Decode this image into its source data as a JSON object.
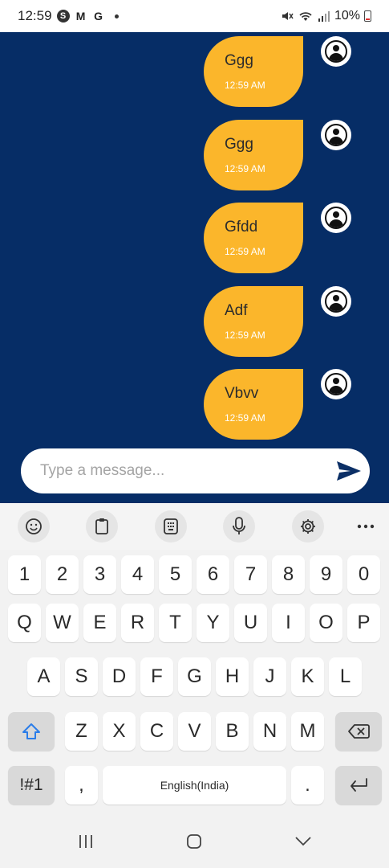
{
  "status_bar": {
    "time": "12:59",
    "apps": [
      "S",
      "M",
      "G"
    ],
    "battery": "10%"
  },
  "messages": [
    {
      "text": "Ggg",
      "time": "12:59 AM"
    },
    {
      "text": "Ggg",
      "time": "12:59 AM"
    },
    {
      "text": "Gfdd",
      "time": "12:59 AM"
    },
    {
      "text": "Adf",
      "time": "12:59 AM"
    },
    {
      "text": "Vbvv",
      "time": "12:59 AM"
    }
  ],
  "composer": {
    "placeholder": "Type a message..."
  },
  "keyboard": {
    "number_row": [
      "1",
      "2",
      "3",
      "4",
      "5",
      "6",
      "7",
      "8",
      "9",
      "0"
    ],
    "row1": [
      "Q",
      "W",
      "E",
      "R",
      "T",
      "Y",
      "U",
      "I",
      "O",
      "P"
    ],
    "row2": [
      "A",
      "S",
      "D",
      "F",
      "G",
      "H",
      "J",
      "K",
      "L"
    ],
    "row3": [
      "Z",
      "X",
      "C",
      "V",
      "B",
      "N",
      "M"
    ],
    "symbols_label": "!#1",
    "comma": ",",
    "space_label": "English(India)",
    "period": "."
  },
  "colors": {
    "chat_background": "#062d66",
    "bubble": "#fbb62b",
    "send_icon": "#0b2f66",
    "shift_icon": "#2b7de9"
  },
  "icons": {
    "toolbar": [
      "emoji-icon",
      "clipboard-icon",
      "keypad-icon",
      "microphone-icon",
      "settings-icon",
      "more-icon"
    ],
    "nav": [
      "recent-apps-icon",
      "home-icon",
      "back-icon"
    ]
  }
}
